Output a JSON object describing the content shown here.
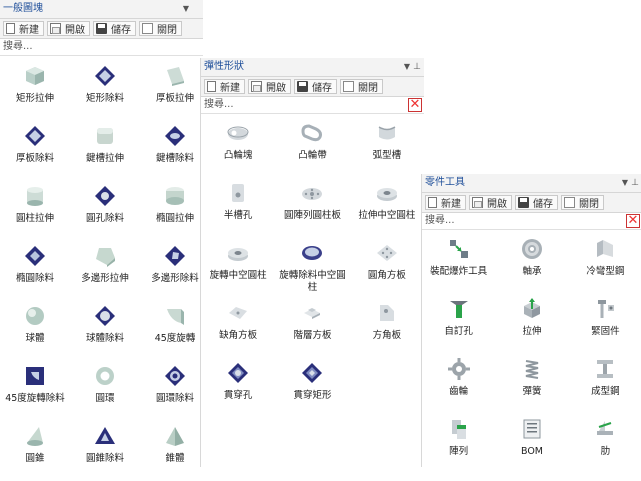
{
  "panels": [
    {
      "title": "一般圖塊",
      "toolbar": [
        "新建",
        "開啟",
        "儲存",
        "關閉"
      ],
      "search_placeholder": "搜尋...",
      "items": [
        {
          "label": "矩形拉伸",
          "icon": "cube"
        },
        {
          "label": "矩形除料",
          "icon": "square-cut"
        },
        {
          "label": "厚板拉伸",
          "icon": "plate"
        },
        {
          "label": "厚板除料",
          "icon": "square-cut"
        },
        {
          "label": "鍵槽拉伸",
          "icon": "slot"
        },
        {
          "label": "鍵槽除料",
          "icon": "slot-cut"
        },
        {
          "label": "圓柱拉伸",
          "icon": "cylinder"
        },
        {
          "label": "圓孔除料",
          "icon": "hole-cut"
        },
        {
          "label": "橢圓拉伸",
          "icon": "ellipse"
        },
        {
          "label": "橢圓除料",
          "icon": "diamond-cut"
        },
        {
          "label": "多邊形拉伸",
          "icon": "polygon"
        },
        {
          "label": "多邊形除料",
          "icon": "polygon-cut"
        },
        {
          "label": "球體",
          "icon": "sphere"
        },
        {
          "label": "球體除料",
          "icon": "sphere-cut"
        },
        {
          "label": "45度旋轉",
          "icon": "quarter"
        },
        {
          "label": "45度旋轉除料",
          "icon": "quarter-cut"
        },
        {
          "label": "圓環",
          "icon": "torus"
        },
        {
          "label": "圓環除料",
          "icon": "torus-cut"
        },
        {
          "label": "圓錐",
          "icon": "cone"
        },
        {
          "label": "圓錐除料",
          "icon": "cone-cut"
        },
        {
          "label": "錐體",
          "icon": "pyramid"
        }
      ]
    },
    {
      "title": "彈性形狀",
      "toolbar": [
        "新建",
        "開啟",
        "儲存",
        "關閉"
      ],
      "search_placeholder": "搜尋...",
      "items": [
        {
          "label": "凸輪塊",
          "icon": "cam"
        },
        {
          "label": "凸輪帶",
          "icon": "cam-belt"
        },
        {
          "label": "弧型槽",
          "icon": "arc-slot"
        },
        {
          "label": "半槽孔",
          "icon": "half-slot"
        },
        {
          "label": "圓陣列圓柱板",
          "icon": "pattern-plate"
        },
        {
          "label": "拉伸中空圓柱",
          "icon": "hollow-cylinder"
        },
        {
          "label": "旋轉中空圓柱",
          "icon": "hollow-cylinder"
        },
        {
          "label": "旋轉除料中空圓柱",
          "icon": "ring-cut"
        },
        {
          "label": "圓角方板",
          "icon": "round-plate"
        },
        {
          "label": "缺角方板",
          "icon": "notch-plate"
        },
        {
          "label": "階層方板",
          "icon": "step-plate"
        },
        {
          "label": "方角板",
          "icon": "angle-plate"
        },
        {
          "label": "貫穿孔",
          "icon": "thru-hole"
        },
        {
          "label": "貫穿矩形",
          "icon": "thru-rect"
        }
      ]
    },
    {
      "title": "零件工具",
      "toolbar": [
        "新建",
        "開啟",
        "儲存",
        "關閉"
      ],
      "search_placeholder": "搜尋...",
      "items": [
        {
          "label": "裝配爆炸工具",
          "icon": "explode"
        },
        {
          "label": "軸承",
          "icon": "bearing"
        },
        {
          "label": "冷彎型鋼",
          "icon": "cold-steel"
        },
        {
          "label": "自訂孔",
          "icon": "custom-hole"
        },
        {
          "label": "拉伸",
          "icon": "extrude"
        },
        {
          "label": "緊固件",
          "icon": "fastener"
        },
        {
          "label": "齒輪",
          "icon": "gear"
        },
        {
          "label": "彈簧",
          "icon": "spring"
        },
        {
          "label": "成型鋼",
          "icon": "i-beam"
        },
        {
          "label": "陣列",
          "icon": "array"
        },
        {
          "label": "BOM",
          "icon": "bom"
        },
        {
          "label": "肋",
          "icon": "rib"
        }
      ]
    }
  ]
}
